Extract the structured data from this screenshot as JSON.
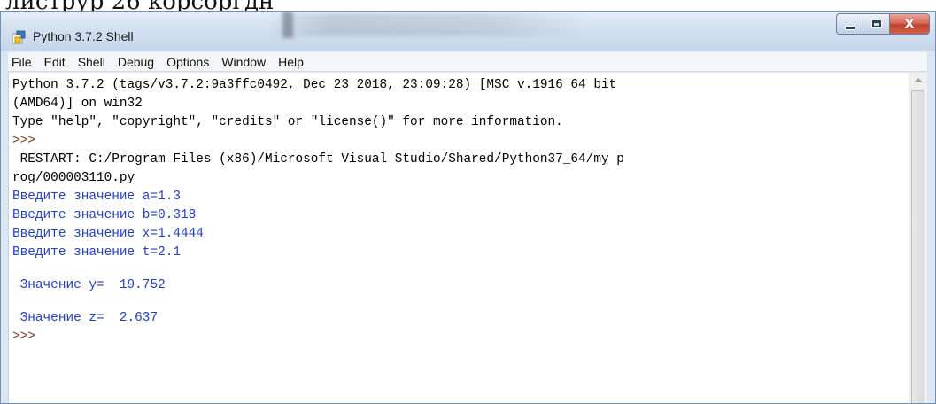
{
  "page_strip": {
    "text": "листрур 26 корсоргдн"
  },
  "window": {
    "title": "Python 3.7.2 Shell",
    "app_icon": "python-idle-icon",
    "controls": {
      "minimize_icon": "minimize-icon",
      "maximize_icon": "maximize-icon",
      "close_glyph": "X"
    }
  },
  "menu": {
    "items": [
      {
        "id": "file",
        "label": "File"
      },
      {
        "id": "edit",
        "label": "Edit"
      },
      {
        "id": "shell",
        "label": "Shell"
      },
      {
        "id": "debug",
        "label": "Debug"
      },
      {
        "id": "options",
        "label": "Options"
      },
      {
        "id": "window",
        "label": "Window"
      },
      {
        "id": "help",
        "label": "Help"
      }
    ]
  },
  "shell": {
    "lines": [
      {
        "text": "Python 3.7.2 (tags/v3.7.2:9a3ffc0492, Dec 23 2018, 23:09:28) [MSC v.1916 64 bit",
        "style": "output"
      },
      {
        "text": "(AMD64)] on win32",
        "style": "output"
      },
      {
        "text": "Type \"help\", \"copyright\", \"credits\" or \"license()\" for more information.",
        "style": "output"
      },
      {
        "text": ">>> ",
        "style": "prompt"
      },
      {
        "text": " RESTART: C:/Program Files (x86)/Microsoft Visual Studio/Shared/Python37_64/my p",
        "style": "output"
      },
      {
        "text": "rog/000003110.py",
        "style": "output"
      },
      {
        "text": "Введите значение a=1.3",
        "style": "blue"
      },
      {
        "text": "Введите значение b=0.318",
        "style": "blue"
      },
      {
        "text": "Введите значение x=1.4444",
        "style": "blue"
      },
      {
        "text": "Введите значение t=2.1",
        "style": "blue"
      },
      {
        "text": "",
        "style": "blank"
      },
      {
        "text": " Значение y=  19.752",
        "style": "blue"
      },
      {
        "text": "",
        "style": "blank"
      },
      {
        "text": " Значение z=  2.637",
        "style": "blue"
      },
      {
        "text": ">>> ",
        "style": "prompt"
      }
    ]
  },
  "colors": {
    "stdout_blue": "#1e3fd0",
    "prompt_brown": "#7a3a1a",
    "titlebar": "#d3e0f0",
    "close_red": "#c0432c"
  }
}
